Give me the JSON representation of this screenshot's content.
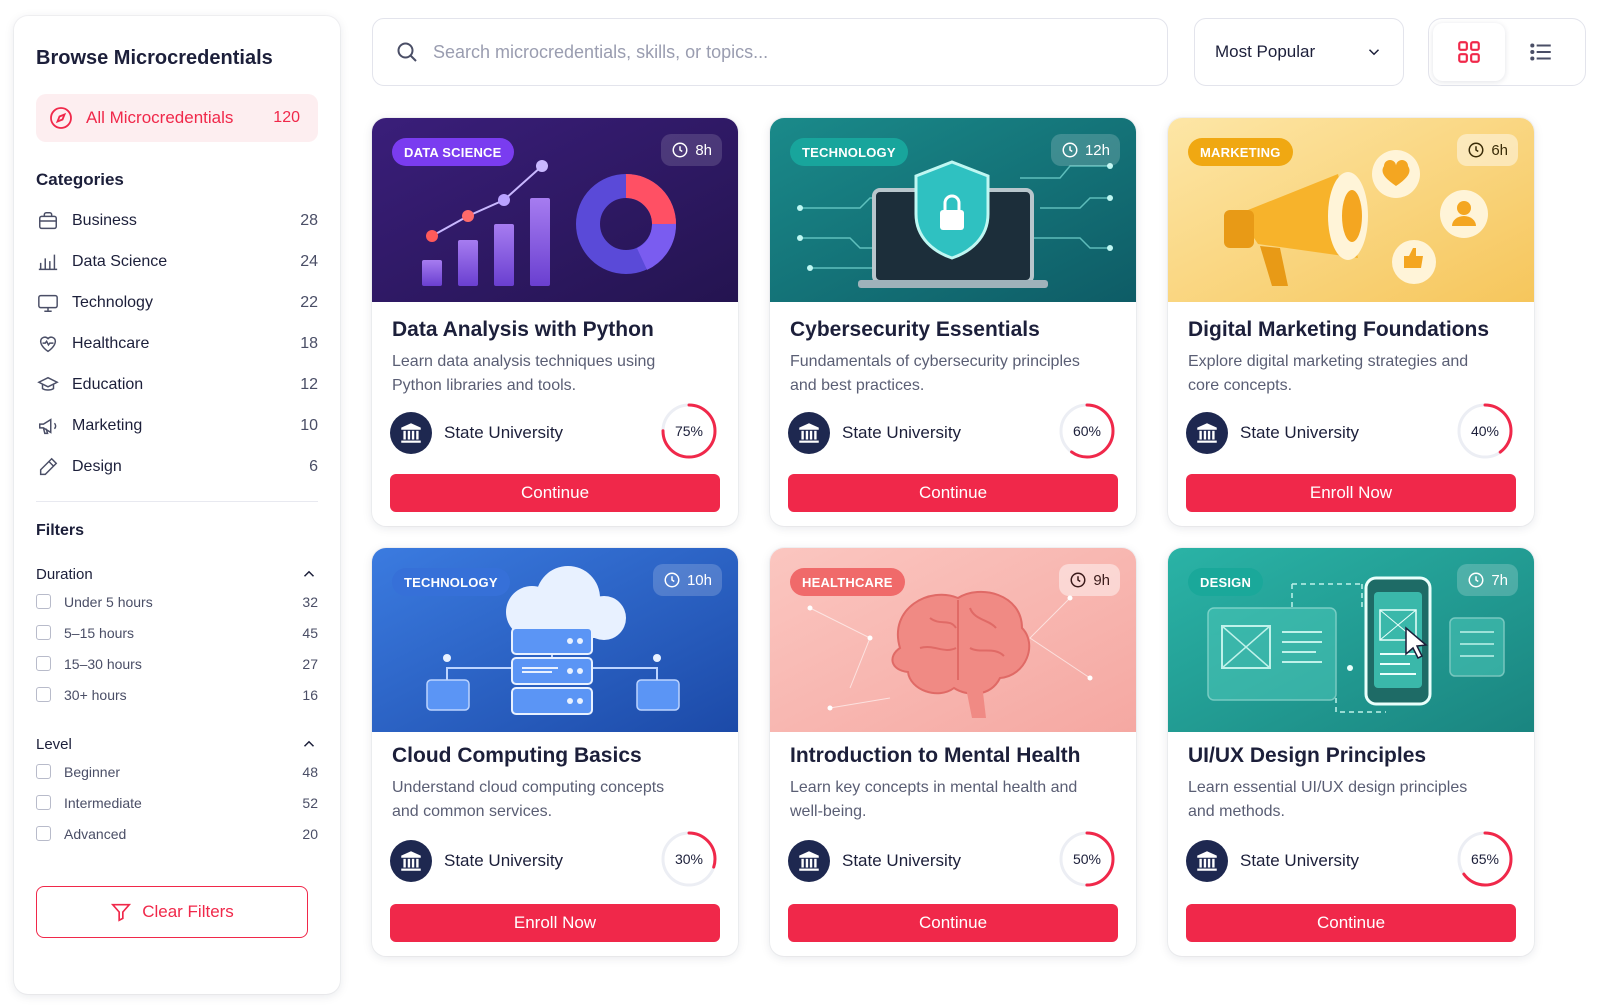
{
  "sidebar": {
    "title": "Browse Microcredentials",
    "all": {
      "label": "All Microcredentials",
      "count": "120"
    },
    "categories_heading": "Categories",
    "categories": [
      {
        "label": "Business",
        "count": "28",
        "icon": "briefcase-icon"
      },
      {
        "label": "Data Science",
        "count": "24",
        "icon": "bar-chart-icon"
      },
      {
        "label": "Technology",
        "count": "22",
        "icon": "monitor-icon"
      },
      {
        "label": "Healthcare",
        "count": "18",
        "icon": "heart-pulse-icon"
      },
      {
        "label": "Education",
        "count": "12",
        "icon": "graduation-cap-icon"
      },
      {
        "label": "Marketing",
        "count": "10",
        "icon": "megaphone-icon"
      },
      {
        "label": "Design",
        "count": "6",
        "icon": "pen-icon"
      }
    ],
    "filters_heading": "Filters",
    "duration": {
      "label": "Duration",
      "options": [
        {
          "label": "Under 5 hours",
          "count": "32"
        },
        {
          "label": "5–15 hours",
          "count": "45"
        },
        {
          "label": "15–30 hours",
          "count": "27"
        },
        {
          "label": "30+ hours",
          "count": "16"
        }
      ]
    },
    "level": {
      "label": "Level",
      "options": [
        {
          "label": "Beginner",
          "count": "48"
        },
        {
          "label": "Intermediate",
          "count": "52"
        },
        {
          "label": "Advanced",
          "count": "20"
        }
      ]
    },
    "clear_label": "Clear Filters"
  },
  "search": {
    "placeholder": "Search microcredentials, skills, or topics..."
  },
  "sort": {
    "selected": "Most Popular"
  },
  "view": {
    "active": "grid"
  },
  "colors": {
    "accent": "#f0284a",
    "navy": "#1e2850"
  },
  "cards": [
    {
      "tag": "DATA SCIENCE",
      "duration": "8h",
      "title": "Data Analysis with Python",
      "desc": "Learn data analysis techniques using Python libraries and tools.",
      "institution": "State University",
      "progress": 75,
      "progress_label": "75%",
      "cta": "Continue"
    },
    {
      "tag": "TECHNOLOGY",
      "duration": "12h",
      "title": "Cybersecurity Essentials",
      "desc": "Fundamentals of cybersecurity principles and best practices.",
      "institution": "State University",
      "progress": 60,
      "progress_label": "60%",
      "cta": "Continue"
    },
    {
      "tag": "MARKETING",
      "duration": "6h",
      "title": "Digital Marketing Foundations",
      "desc": "Explore digital marketing strategies and core concepts.",
      "institution": "State University",
      "progress": 40,
      "progress_label": "40%",
      "cta": "Enroll Now"
    },
    {
      "tag": "TECHNOLOGY",
      "duration": "10h",
      "title": "Cloud Computing Basics",
      "desc": "Understand cloud computing concepts and common services.",
      "institution": "State University",
      "progress": 30,
      "progress_label": "30%",
      "cta": "Enroll Now"
    },
    {
      "tag": "HEALTHCARE",
      "duration": "9h",
      "title": "Introduction to Mental Health",
      "desc": "Learn key concepts in mental health and well-being.",
      "institution": "State University",
      "progress": 50,
      "progress_label": "50%",
      "cta": "Continue"
    },
    {
      "tag": "DESIGN",
      "duration": "7h",
      "title": "UI/UX Design Principles",
      "desc": "Learn essential UI/UX design principles and methods.",
      "institution": "State University",
      "progress": 65,
      "progress_label": "65%",
      "cta": "Continue"
    }
  ]
}
